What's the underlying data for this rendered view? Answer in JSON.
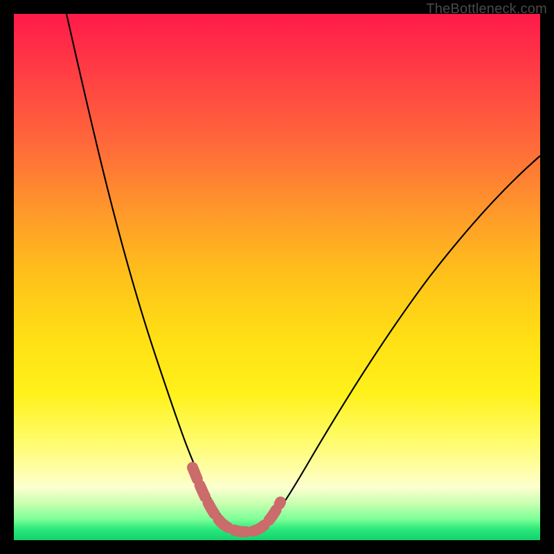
{
  "watermark": "TheBottleneck.com",
  "colors": {
    "frame": "#000000",
    "gradient_top": "#ff1a4a",
    "gradient_mid1": "#ff9a2a",
    "gradient_mid2": "#ffe015",
    "gradient_bottom": "#14d26e",
    "curve": "#000000",
    "highlight": "#cc6b6b"
  },
  "chart_data": {
    "type": "line",
    "title": "",
    "xlabel": "",
    "ylabel": "",
    "xlim": [
      0,
      100
    ],
    "ylim": [
      0,
      100
    ],
    "series": [
      {
        "name": "bottleneck-curve",
        "x": [
          10,
          15,
          20,
          25,
          30,
          33,
          36,
          38,
          40,
          42,
          44,
          46,
          50,
          55,
          60,
          65,
          70,
          80,
          90,
          100
        ],
        "y": [
          100,
          78,
          58,
          40,
          25,
          16,
          10,
          6,
          3,
          2,
          2,
          3,
          6,
          12,
          20,
          28,
          35,
          48,
          59,
          70
        ]
      }
    ],
    "annotations": [
      {
        "name": "valley-highlight",
        "x_range": [
          33,
          46
        ],
        "note": "pink/coral thick stroke marking the curve bottom"
      }
    ]
  }
}
